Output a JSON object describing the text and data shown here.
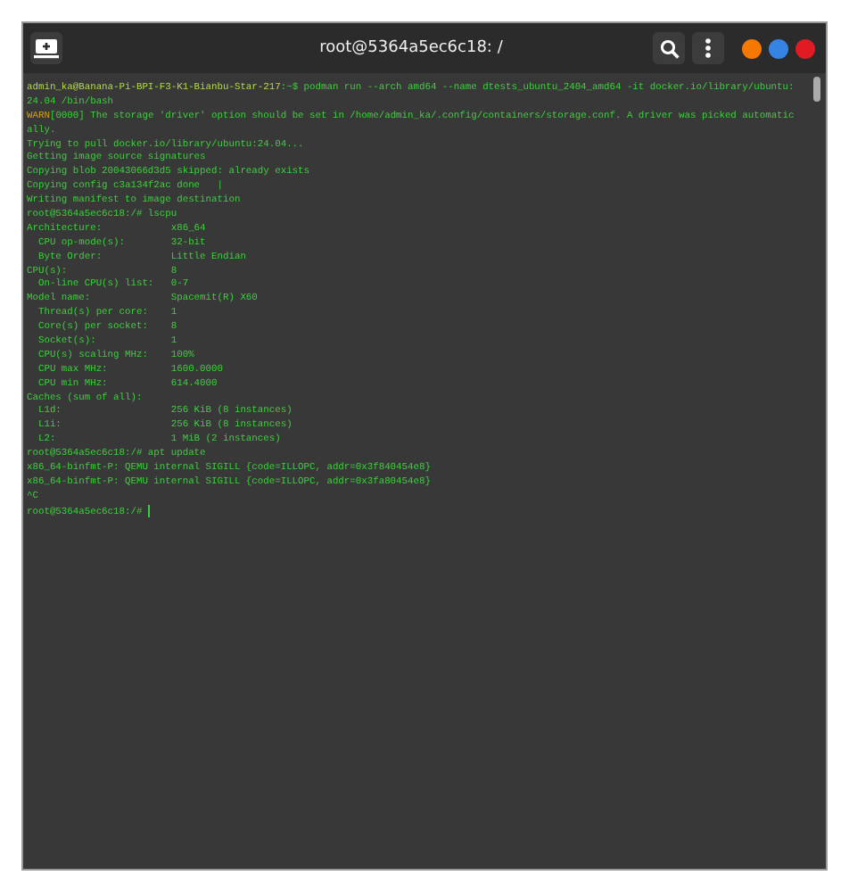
{
  "window": {
    "title": "root@5364a5ec6c18: /"
  },
  "lines": [
    {
      "segments": [
        {
          "kind": "host",
          "text": "admin_ka@Banana-Pi-BPI-F3-K1-Bianbu-Star-217"
        },
        {
          "kind": "normal",
          "text": ":~$ podman run --arch amd64 --name dtests_ubuntu_2404_amd64 -it docker.io/library/ubuntu:"
        }
      ]
    },
    {
      "segments": [
        {
          "kind": "normal",
          "text": "24.04 /bin/bash"
        }
      ]
    },
    {
      "segments": [
        {
          "kind": "warn",
          "text": "WARN"
        },
        {
          "kind": "normal",
          "text": "[0000] The storage 'driver' option should be set in /home/admin_ka/.config/containers/storage.conf. A driver was picked automatic"
        }
      ]
    },
    {
      "segments": [
        {
          "kind": "normal",
          "text": "ally."
        }
      ]
    },
    {
      "segments": [
        {
          "kind": "normal",
          "text": "Trying to pull docker.io/library/ubuntu:24.04..."
        }
      ]
    },
    {
      "segments": [
        {
          "kind": "normal",
          "text": "Getting image source signatures"
        }
      ]
    },
    {
      "segments": [
        {
          "kind": "normal",
          "text": "Copying blob 20043066d3d5 skipped: already exists"
        }
      ]
    },
    {
      "segments": [
        {
          "kind": "normal",
          "text": "Copying config c3a134f2ac done   |"
        }
      ]
    },
    {
      "segments": [
        {
          "kind": "normal",
          "text": "Writing manifest to image destination"
        }
      ]
    },
    {
      "segments": [
        {
          "kind": "normal",
          "text": "root@5364a5ec6c18:/# lscpu"
        }
      ]
    },
    {
      "segments": [
        {
          "kind": "normal",
          "text": "Architecture:            x86_64"
        }
      ]
    },
    {
      "segments": [
        {
          "kind": "normal",
          "text": "  CPU op-mode(s):        32-bit"
        }
      ]
    },
    {
      "segments": [
        {
          "kind": "normal",
          "text": "  Byte Order:            Little Endian"
        }
      ]
    },
    {
      "segments": [
        {
          "kind": "normal",
          "text": "CPU(s):                  8"
        }
      ]
    },
    {
      "segments": [
        {
          "kind": "normal",
          "text": "  On-line CPU(s) list:   0-7"
        }
      ]
    },
    {
      "segments": [
        {
          "kind": "normal",
          "text": "Model name:              Spacemit(R) X60"
        }
      ]
    },
    {
      "segments": [
        {
          "kind": "normal",
          "text": "  Thread(s) per core:    1"
        }
      ]
    },
    {
      "segments": [
        {
          "kind": "normal",
          "text": "  Core(s) per socket:    8"
        }
      ]
    },
    {
      "segments": [
        {
          "kind": "normal",
          "text": "  Socket(s):             1"
        }
      ]
    },
    {
      "segments": [
        {
          "kind": "normal",
          "text": "  CPU(s) scaling MHz:    100%"
        }
      ]
    },
    {
      "segments": [
        {
          "kind": "normal",
          "text": "  CPU max MHz:           1600.0000"
        }
      ]
    },
    {
      "segments": [
        {
          "kind": "normal",
          "text": "  CPU min MHz:           614.4000"
        }
      ]
    },
    {
      "segments": [
        {
          "kind": "normal",
          "text": "Caches (sum of all):"
        }
      ]
    },
    {
      "segments": [
        {
          "kind": "normal",
          "text": "  L1d:                   256 KiB (8 instances)"
        }
      ]
    },
    {
      "segments": [
        {
          "kind": "normal",
          "text": "  L1i:                   256 KiB (8 instances)"
        }
      ]
    },
    {
      "segments": [
        {
          "kind": "normal",
          "text": "  L2:                    1 MiB (2 instances)"
        }
      ]
    },
    {
      "segments": [
        {
          "kind": "normal",
          "text": "root@5364a5ec6c18:/# apt update"
        }
      ]
    },
    {
      "segments": [
        {
          "kind": "normal",
          "text": "x86_64-binfmt-P: QEMU internal SIGILL {code=ILLOPC, addr=0x3f840454e8}"
        }
      ]
    },
    {
      "segments": [
        {
          "kind": "normal",
          "text": "x86_64-binfmt-P: QEMU internal SIGILL {code=ILLOPC, addr=0x3fa80454e8}"
        }
      ]
    },
    {
      "segments": [
        {
          "kind": "normal",
          "text": "^C"
        }
      ]
    },
    {
      "segments": [
        {
          "kind": "normal",
          "text": "root@5364a5ec6c18:/# "
        },
        {
          "kind": "cursor"
        }
      ]
    }
  ]
}
